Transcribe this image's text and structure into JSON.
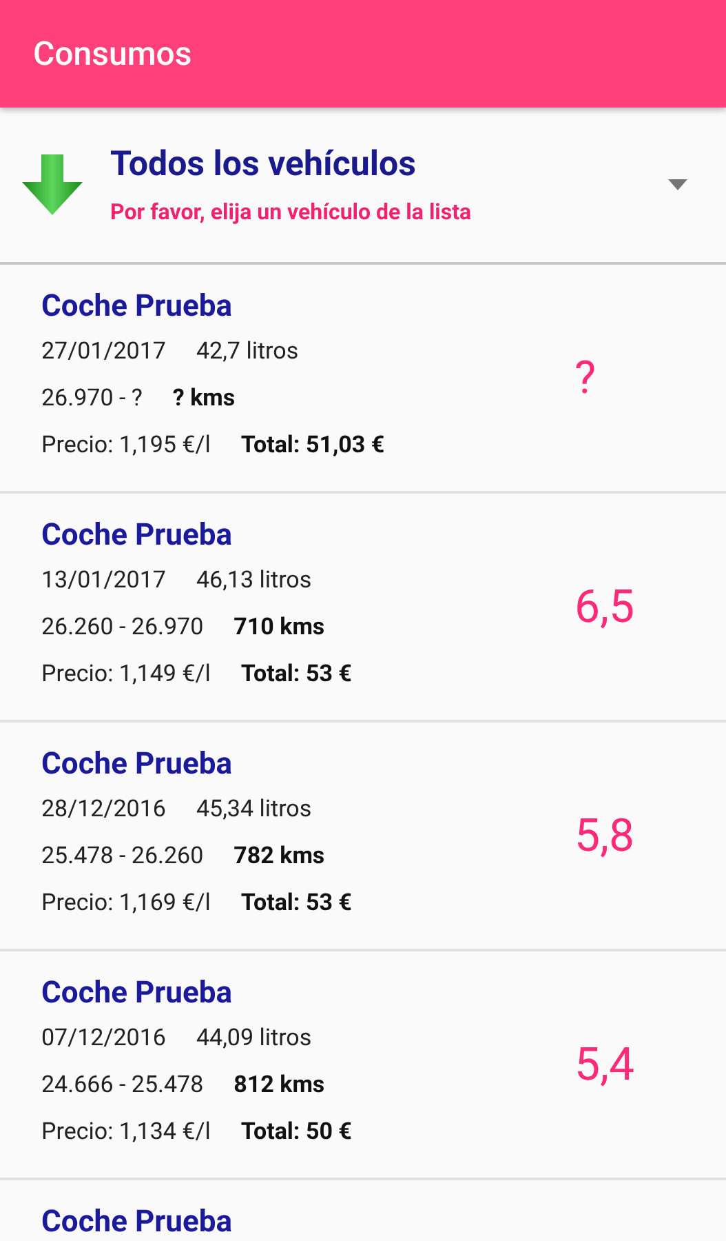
{
  "app_bar": {
    "title": "Consumos"
  },
  "vehicle_selector": {
    "title": "Todos los vehículos",
    "hint": "Por favor, elija un vehículo de la lista"
  },
  "entries": [
    {
      "vehicle": "Coche Prueba",
      "date": "27/01/2017",
      "liters": "42,7 litros",
      "odometer": "26.970 - ?",
      "distance": "? kms",
      "price": "Precio: 1,195 €/l",
      "total": "Total: 51,03 €",
      "consumption": "?"
    },
    {
      "vehicle": "Coche Prueba",
      "date": "13/01/2017",
      "liters": "46,13 litros",
      "odometer": "26.260 - 26.970",
      "distance": "710 kms",
      "price": "Precio: 1,149 €/l",
      "total": "Total: 53 €",
      "consumption": "6,5"
    },
    {
      "vehicle": "Coche Prueba",
      "date": "28/12/2016",
      "liters": "45,34 litros",
      "odometer": "25.478 - 26.260",
      "distance": "782 kms",
      "price": "Precio: 1,169 €/l",
      "total": "Total: 53 €",
      "consumption": "5,8"
    },
    {
      "vehicle": "Coche Prueba",
      "date": "07/12/2016",
      "liters": "44,09 litros",
      "odometer": "24.666 - 25.478",
      "distance": "812 kms",
      "price": "Precio: 1,134 €/l",
      "total": "Total: 50 €",
      "consumption": "5,4"
    },
    {
      "vehicle": "Coche Prueba"
    }
  ]
}
